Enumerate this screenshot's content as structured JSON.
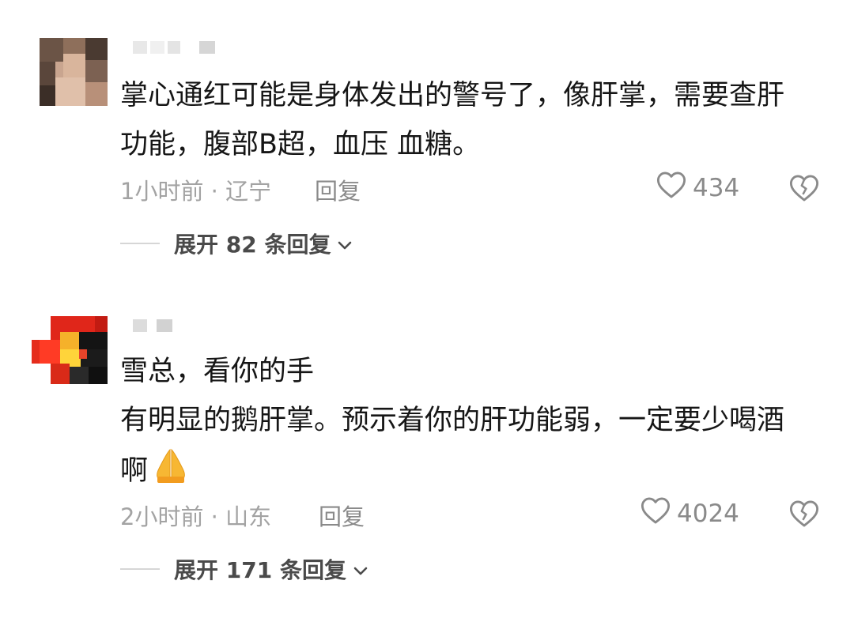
{
  "comments": [
    {
      "text_lines": [
        "掌心通红可能是身体发出的警号了，像肝掌，需要查肝",
        "功能，腹部B超，血压 血糖。"
      ],
      "time_location": "1小时前 · 辽宁",
      "reply_label": "回复",
      "likes": "434",
      "expand_label": "展开 82 条回复"
    },
    {
      "text_lines": [
        "雪总，看你的手",
        "有明显的鹅肝掌。预示着你的肝功能弱，一定要少喝酒",
        "啊"
      ],
      "time_location": "2小时前 · 山东",
      "reply_label": "回复",
      "likes": "4024",
      "expand_label": "展开 171 条回复"
    }
  ],
  "icons": {
    "like": "heart-outline-icon",
    "dislike": "broken-heart-icon",
    "expand": "chevron-down-icon",
    "emoji": "folded-hands-emoji"
  },
  "colors": {
    "text": "#161616",
    "meta": "#a3a3a3",
    "action": "#8a8a8a"
  }
}
